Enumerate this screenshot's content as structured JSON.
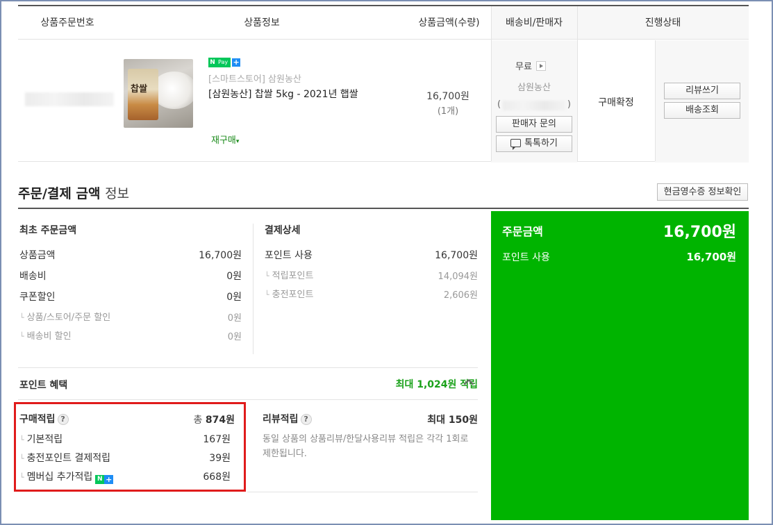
{
  "table": {
    "headers": [
      "상품주문번호",
      "상품정보",
      "상품금액(수량)",
      "배송비/판매자",
      "진행상태"
    ],
    "product": {
      "npay_n": "N",
      "npay_pay": "Pay",
      "npay_plus": "+",
      "thumb_text": "찹쌀",
      "store": "[스마트스토어] 삼원농산",
      "name": "[삼원농산] 찹쌀 5kg - 2021년 햅쌀",
      "rebuy": "재구매",
      "price": "16,700원",
      "qty": "(1개)"
    },
    "shipping": {
      "fee": "무료",
      "seller": "삼원농산",
      "paren_open": "(",
      "paren_close": ")",
      "inquiry_button": "판매자 문의",
      "talk_button": "톡톡하기"
    },
    "status": "구매확정",
    "review_button": "리뷰쓰기",
    "tracking_button": "배송조회"
  },
  "payment": {
    "title_main": "주문/결제 금액",
    "title_light": "정보",
    "receipt_button": "현금영수증 정보확인",
    "initial": {
      "title": "최초 주문금액",
      "rows": [
        {
          "label": "상품금액",
          "value": "16,700원"
        },
        {
          "label": "배송비",
          "value": "0원"
        },
        {
          "label": "쿠폰할인",
          "value": "0원"
        },
        {
          "label": "상품/스토어/주문 할인",
          "value": "0원"
        },
        {
          "label": "배송비 할인",
          "value": "0원"
        }
      ]
    },
    "detail": {
      "title": "결제상세",
      "rows": [
        {
          "label": "포인트 사용",
          "value": "16,700원"
        },
        {
          "label": "적립포인트",
          "value": "14,094원"
        },
        {
          "label": "충전포인트",
          "value": "2,606원"
        }
      ]
    },
    "summary": {
      "order_label": "주문금액",
      "order_value": "16,700원",
      "point_label": "포인트 사용",
      "point_value": "16,700원"
    }
  },
  "points": {
    "title": "포인트 혜택",
    "max": "최대 1,024원 적립",
    "purchase": {
      "title": "구매적립",
      "total_prefix": "총",
      "total": "874원",
      "rows": [
        {
          "label": "기본적립",
          "value": "167원"
        },
        {
          "label": "충전포인트 결제적립",
          "value": "39원"
        },
        {
          "label": "멤버십 추가적립",
          "value": "668원"
        }
      ]
    },
    "review": {
      "title": "리뷰적립",
      "max": "최대 150원",
      "note": "동일 상품의 상품리뷰/한달사용리뷰 적립은 각각 1회로 제한됩니다."
    },
    "help_icon": "?"
  }
}
